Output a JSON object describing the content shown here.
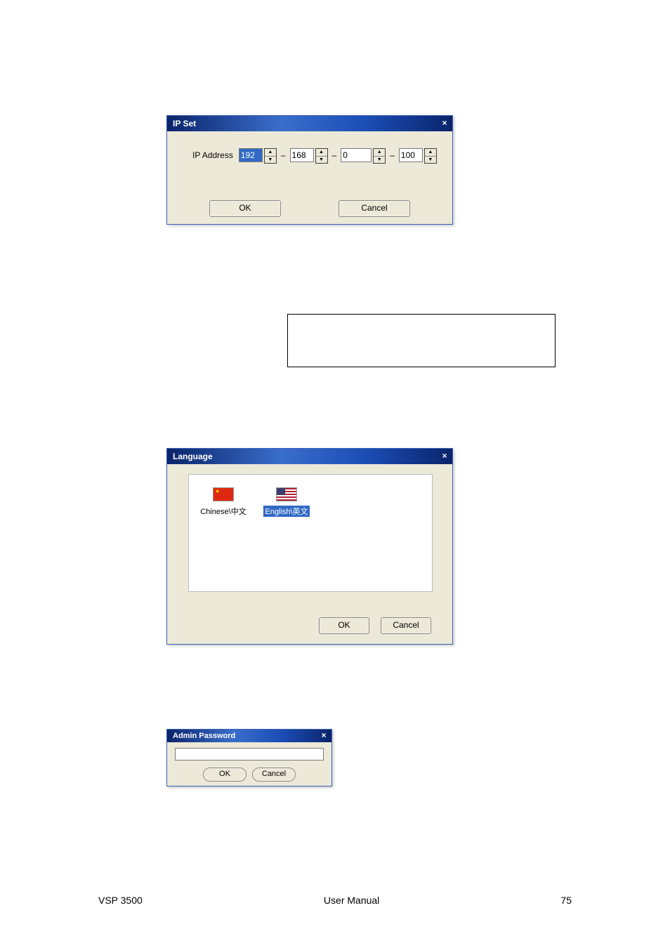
{
  "ipset": {
    "title": "IP Set",
    "label": "IP Address",
    "oct1": "192",
    "oct2": "168",
    "oct3": "0",
    "oct4": "100",
    "ok": "OK",
    "cancel": "Cancel"
  },
  "language": {
    "title": "Language",
    "items": [
      {
        "label": "Chinese\\中文",
        "selected": false
      },
      {
        "label": "English\\英文",
        "selected": true
      }
    ],
    "ok": "OK",
    "cancel": "Cancel"
  },
  "admin": {
    "title": "Admin Password",
    "value": "",
    "ok": "OK",
    "cancel": "Cancel"
  },
  "footer": {
    "left": "VSP 3500",
    "center": "User Manual",
    "right": "75"
  }
}
